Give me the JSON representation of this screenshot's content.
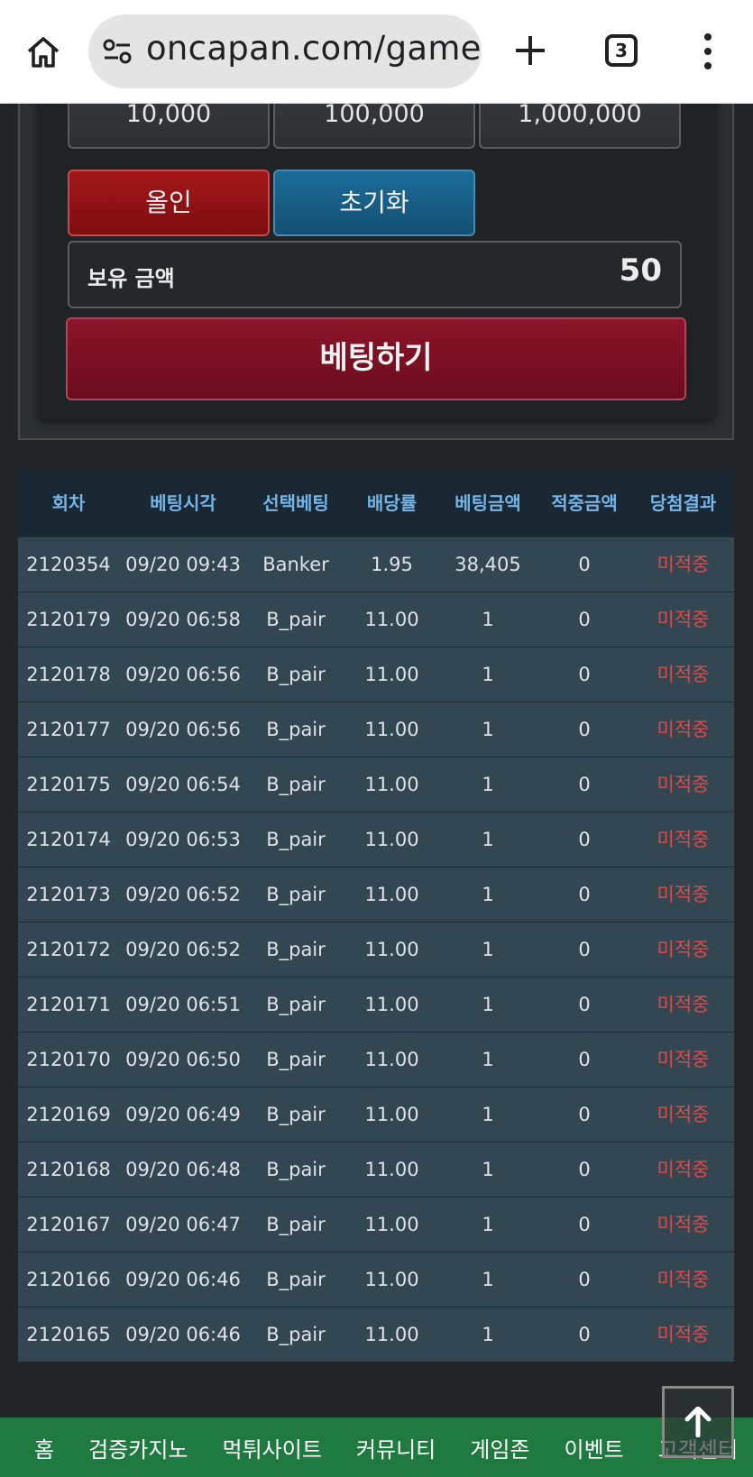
{
  "browser": {
    "url": "oncapan.com/gamezo",
    "tab_count": "3",
    "icons": [
      "home-icon",
      "site-settings-icon",
      "new-tab-plus-icon",
      "tab-switcher-icon",
      "more-menu-icon"
    ]
  },
  "bet_panel": {
    "chips": [
      "10,000",
      "100,000",
      "1,000,000"
    ],
    "allin_label": "올인",
    "reset_label": "초기화",
    "balance_label": "보유 금액",
    "balance_value": "50",
    "bet_button_label": "베팅하기"
  },
  "history": {
    "columns": [
      "회차",
      "베팅시각",
      "선택베팅",
      "배당률",
      "베팅금액",
      "적중금액",
      "당첨결과"
    ],
    "rows": [
      [
        "2120354",
        "09/20 09:43",
        "Banker",
        "1.95",
        "38,405",
        "0",
        "미적중"
      ],
      [
        "2120179",
        "09/20 06:58",
        "B_pair",
        "11.00",
        "1",
        "0",
        "미적중"
      ],
      [
        "2120178",
        "09/20 06:56",
        "B_pair",
        "11.00",
        "1",
        "0",
        "미적중"
      ],
      [
        "2120177",
        "09/20 06:56",
        "B_pair",
        "11.00",
        "1",
        "0",
        "미적중"
      ],
      [
        "2120175",
        "09/20 06:54",
        "B_pair",
        "11.00",
        "1",
        "0",
        "미적중"
      ],
      [
        "2120174",
        "09/20 06:53",
        "B_pair",
        "11.00",
        "1",
        "0",
        "미적중"
      ],
      [
        "2120173",
        "09/20 06:52",
        "B_pair",
        "11.00",
        "1",
        "0",
        "미적중"
      ],
      [
        "2120172",
        "09/20 06:52",
        "B_pair",
        "11.00",
        "1",
        "0",
        "미적중"
      ],
      [
        "2120171",
        "09/20 06:51",
        "B_pair",
        "11.00",
        "1",
        "0",
        "미적중"
      ],
      [
        "2120170",
        "09/20 06:50",
        "B_pair",
        "11.00",
        "1",
        "0",
        "미적중"
      ],
      [
        "2120169",
        "09/20 06:49",
        "B_pair",
        "11.00",
        "1",
        "0",
        "미적중"
      ],
      [
        "2120168",
        "09/20 06:48",
        "B_pair",
        "11.00",
        "1",
        "0",
        "미적중"
      ],
      [
        "2120167",
        "09/20 06:47",
        "B_pair",
        "11.00",
        "1",
        "0",
        "미적중"
      ],
      [
        "2120166",
        "09/20 06:46",
        "B_pair",
        "11.00",
        "1",
        "0",
        "미적중"
      ],
      [
        "2120165",
        "09/20 06:46",
        "B_pair",
        "11.00",
        "1",
        "0",
        "미적중"
      ]
    ]
  },
  "bottom_nav": {
    "items": [
      "홈",
      "검증카지노",
      "먹튀사이트",
      "커뮤니티",
      "게임존",
      "이벤트",
      "고객센터"
    ]
  },
  "scroll_top_icon": "arrow-up-icon",
  "colors": {
    "allin": "#8f1214",
    "reset": "#175d86",
    "bet": "#7c1023",
    "header_text": "#74b4e6",
    "loss_text": "#e04848",
    "nav_green": "#1e7a3e"
  }
}
